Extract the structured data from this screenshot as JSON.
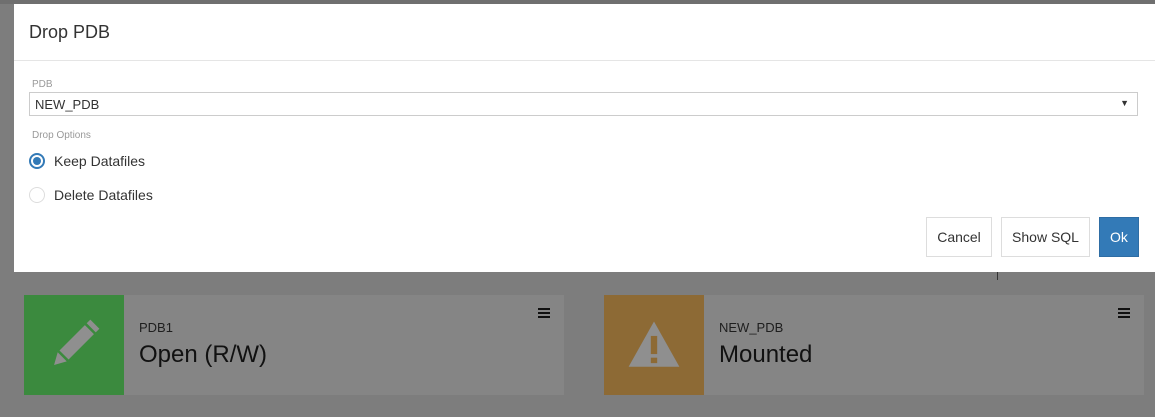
{
  "modal": {
    "title": "Drop PDB",
    "pdb_label": "PDB",
    "pdb_selected": "NEW_PDB",
    "drop_options_label": "Drop Options",
    "options": [
      {
        "label": "Keep Datafiles",
        "checked": true
      },
      {
        "label": "Delete Datafiles",
        "checked": false
      }
    ],
    "buttons": {
      "cancel": "Cancel",
      "show_sql": "Show SQL",
      "ok": "Ok"
    }
  },
  "cards": [
    {
      "name": "PDB1",
      "status": "Open (R/W)",
      "icon": "pencil-icon",
      "color": "#3b8a3e"
    },
    {
      "name": "NEW_PDB",
      "status": "Mounted",
      "icon": "warning-icon",
      "color": "#8d6a35"
    }
  ],
  "colors": {
    "primary": "#337ab7",
    "overlay": "#7d7d7d"
  }
}
